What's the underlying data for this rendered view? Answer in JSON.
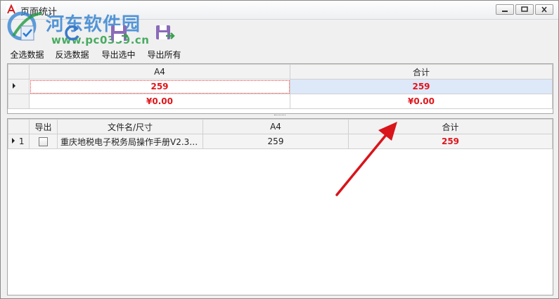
{
  "window": {
    "title": "页面统计"
  },
  "watermark": {
    "brand": "河东软件园",
    "url": "www.pc0359.cn"
  },
  "toolbar": {
    "select_all": "全选数据",
    "invert_selection": "反选数据",
    "export_selected": "导出选中",
    "export_all": "导出所有"
  },
  "summary": {
    "headers": [
      "A4",
      "合计"
    ],
    "rows": [
      {
        "a4": "259",
        "total": "259"
      },
      {
        "a4": "¥0.00",
        "total": "¥0.00"
      }
    ]
  },
  "files": {
    "headers": [
      "导出",
      "文件名/尺寸",
      "A4",
      "合计"
    ],
    "rows": [
      {
        "index": "1",
        "name": "重庆地税电子税务局操作手册V2.3....",
        "a4": "259",
        "total": "259"
      }
    ]
  },
  "colors": {
    "accent_red": "#e0161b",
    "selection_blue": "#dde8f8",
    "arrow": "#d9141b"
  }
}
